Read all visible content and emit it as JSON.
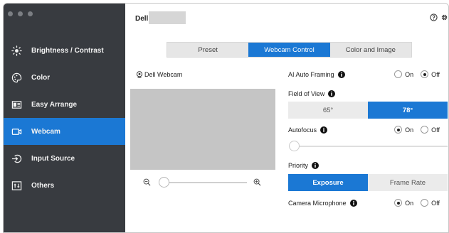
{
  "sidebar": {
    "items": [
      {
        "label": "Brightness / Contrast",
        "icon": "sun-icon"
      },
      {
        "label": "Color",
        "icon": "palette-icon"
      },
      {
        "label": "Easy Arrange",
        "icon": "layout-icon"
      },
      {
        "label": "Webcam",
        "icon": "webcam-icon",
        "active": true
      },
      {
        "label": "Input Source",
        "icon": "input-source-icon"
      },
      {
        "label": "Others",
        "icon": "others-icon"
      }
    ]
  },
  "header": {
    "brand": "Dell",
    "help_icon": "help-icon",
    "settings_icon": "gear-icon"
  },
  "tabs": [
    {
      "label": "Preset"
    },
    {
      "label": "Webcam Control",
      "active": true
    },
    {
      "label": "Color and Image"
    }
  ],
  "webcam": {
    "label": "Dell Webcam"
  },
  "settings": {
    "ai_auto_framing": {
      "label": "AI Auto Framing",
      "on_label": "On",
      "off_label": "Off",
      "value": "Off"
    },
    "field_of_view": {
      "label": "Field of View",
      "options": [
        "65°",
        "78°"
      ],
      "selected": "78°"
    },
    "autofocus": {
      "label": "Autofocus",
      "on_label": "On",
      "off_label": "Off",
      "value": "On"
    },
    "priority": {
      "label": "Priority",
      "options": [
        "Exposure",
        "Frame Rate"
      ],
      "selected": "Exposure"
    },
    "camera_microphone": {
      "label": "Camera Microphone",
      "on_label": "On",
      "off_label": "Off",
      "value": "On"
    }
  },
  "colors": {
    "accent": "#1b78d4",
    "sidebar_bg": "#383b40"
  }
}
